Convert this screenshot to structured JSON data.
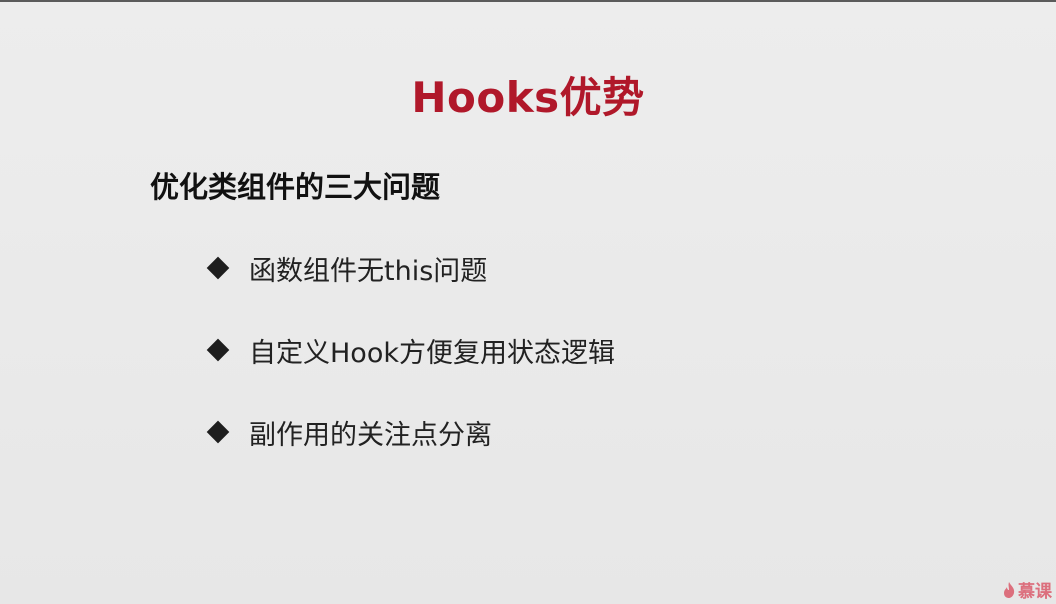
{
  "title": "Hooks优势",
  "subtitle": "优化类组件的三大问题",
  "bullets": [
    "函数组件无this问题",
    "自定义Hook方便复用状态逻辑",
    "副作用的关注点分离"
  ],
  "watermark": {
    "text": "慕课",
    "icon": "flame-icon"
  },
  "colors": {
    "title": "#b0182a",
    "text": "#222222",
    "watermark": "#d9485a"
  }
}
